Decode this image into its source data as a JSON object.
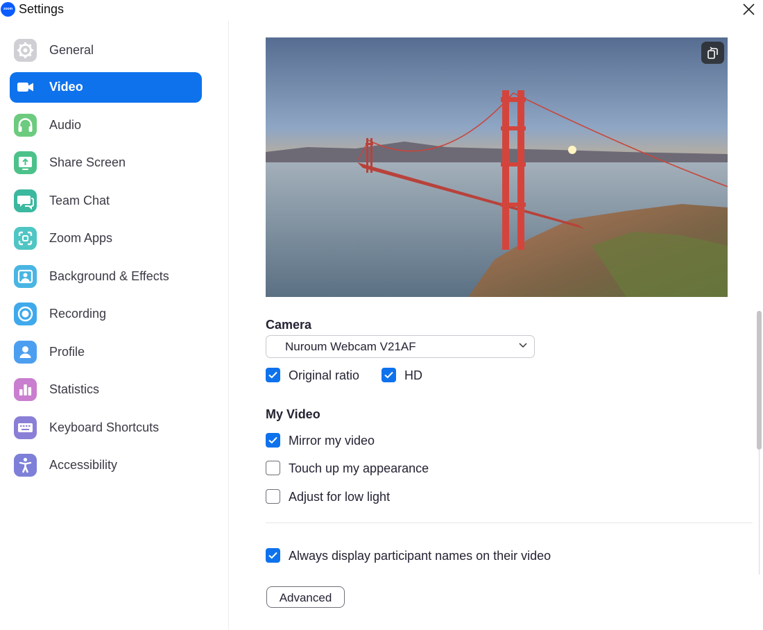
{
  "window": {
    "title": "Settings",
    "logo_text": "zoom"
  },
  "sidebar": {
    "items": [
      {
        "label": "General",
        "icon": "gear-icon",
        "color": "#c9c9ce",
        "active": false
      },
      {
        "label": "Video",
        "icon": "video-camera-icon",
        "color": "#ffffff",
        "active": true
      },
      {
        "label": "Audio",
        "icon": "headphones-icon",
        "color": "#6ccb7e",
        "active": false
      },
      {
        "label": "Share Screen",
        "icon": "share-screen-icon",
        "color": "#4cc28a",
        "active": false
      },
      {
        "label": "Team Chat",
        "icon": "chat-icon",
        "color": "#3bb8a0",
        "active": false
      },
      {
        "label": "Zoom Apps",
        "icon": "apps-icon",
        "color": "#4fc6c4",
        "active": false
      },
      {
        "label": "Background & Effects",
        "icon": "background-icon",
        "color": "#49b5e3",
        "active": false
      },
      {
        "label": "Recording",
        "icon": "recording-icon",
        "color": "#3fa9ec",
        "active": false
      },
      {
        "label": "Profile",
        "icon": "profile-icon",
        "color": "#4c9ff0",
        "active": false
      },
      {
        "label": "Statistics",
        "icon": "statistics-icon",
        "color": "#c97ecf",
        "active": false
      },
      {
        "label": "Keyboard Shortcuts",
        "icon": "keyboard-icon",
        "color": "#8a7fd6",
        "active": false
      },
      {
        "label": "Accessibility",
        "icon": "accessibility-icon",
        "color": "#7d7fd8",
        "active": false
      }
    ]
  },
  "content": {
    "preview": {
      "image": "golden-gate-bridge-sunset"
    },
    "camera": {
      "title": "Camera",
      "selected": "Nuroum Webcam V21AF",
      "original_ratio": {
        "label": "Original ratio",
        "checked": true
      },
      "hd": {
        "label": "HD",
        "checked": true
      }
    },
    "my_video": {
      "title": "My Video",
      "mirror": {
        "label": "Mirror my video",
        "checked": true
      },
      "touch_up": {
        "label": "Touch up my appearance",
        "checked": false
      },
      "low_light": {
        "label": "Adjust for low light",
        "checked": false
      }
    },
    "names": {
      "label": "Always display participant names on their video",
      "checked": true
    },
    "advanced_label": "Advanced"
  },
  "colors": {
    "accent": "#0e72ed",
    "text": "#232333"
  }
}
